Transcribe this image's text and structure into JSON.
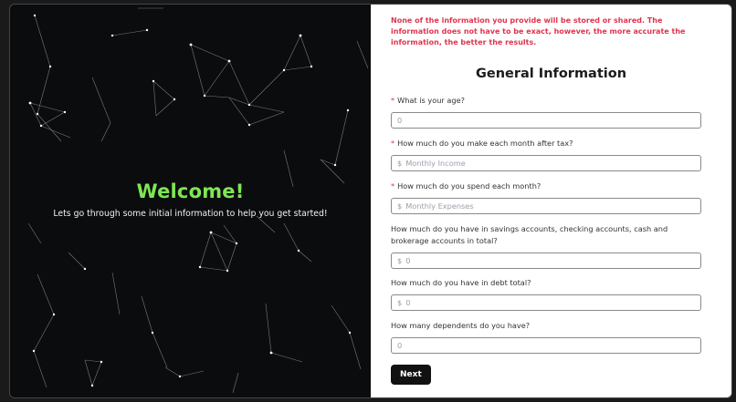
{
  "welcome": {
    "title": "Welcome!",
    "subtitle": "Lets go through some initial information to help you get started!"
  },
  "form": {
    "notice": "None of the information you provide will be stored or shared. The information does not have to be exact, however, the more accurate the information, the better the results.",
    "title": "General Information",
    "fields": [
      {
        "label": "What is your age?",
        "required": "*",
        "prefix": "",
        "placeholder": "0"
      },
      {
        "label": "How much do you make each month after tax?",
        "required": "*",
        "prefix": "$",
        "placeholder": "Monthly Income"
      },
      {
        "label": "How much do you spend each month?",
        "required": "*",
        "prefix": "$",
        "placeholder": "Monthly Expenses"
      },
      {
        "label": "How much do you have in savings accounts, checking accounts, cash and brokerage accounts in total?",
        "required": "",
        "prefix": "$",
        "placeholder": "0"
      },
      {
        "label": "How much do you have in debt total?",
        "required": "",
        "prefix": "$",
        "placeholder": "0"
      },
      {
        "label": "How many dependents do you have?",
        "required": "",
        "prefix": "",
        "placeholder": "0"
      }
    ],
    "next_label": "Next"
  },
  "colors": {
    "welcome_green": "#7ee655",
    "notice_red": "#e0344c",
    "left_bg": "#0b0c0d"
  }
}
